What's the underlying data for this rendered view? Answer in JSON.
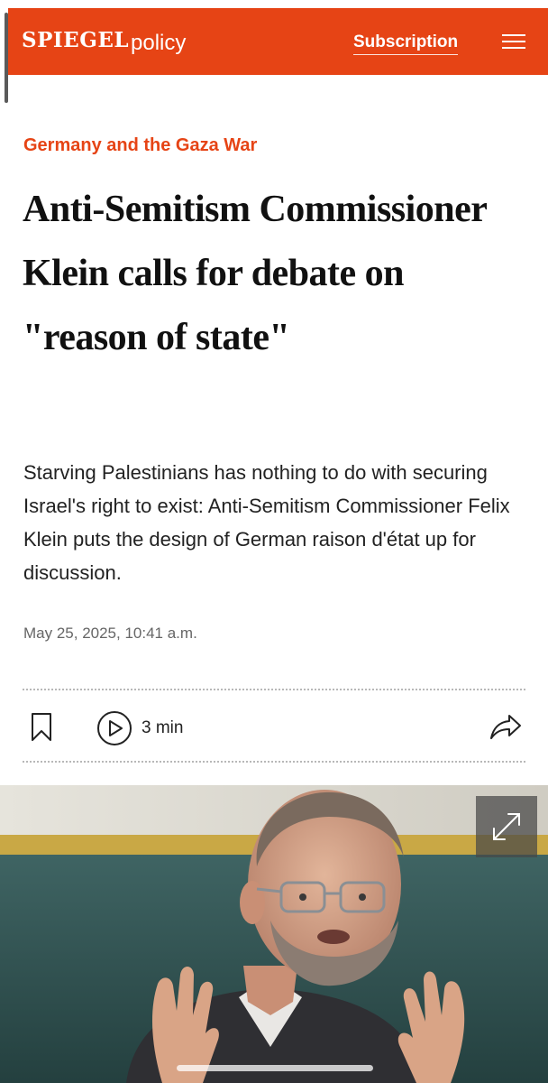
{
  "header": {
    "logo": "SPIEGEL",
    "section": "policy",
    "subscription_label": "Subscription",
    "menu_icon": "hamburger-menu-icon",
    "brand_color": "#e64415"
  },
  "article": {
    "kicker": "Germany and the Gaza War",
    "headline": "Anti-Semitism Commissioner Klein calls for debate on \"reason of state\"",
    "teaser": "Starving Palestinians has nothing to do with securing Israel's right to exist: Anti-Semitism Commissioner Felix Klein puts the design of German raison d'état up for discussion.",
    "date": "May 25, 2025, 10:41 a.m."
  },
  "actions": {
    "bookmark_icon": "bookmark-icon",
    "play_icon": "play-circle-icon",
    "audio_duration": "3 min",
    "share_icon": "share-arrow-icon"
  },
  "hero_image": {
    "description_icon": "expand-icon"
  }
}
